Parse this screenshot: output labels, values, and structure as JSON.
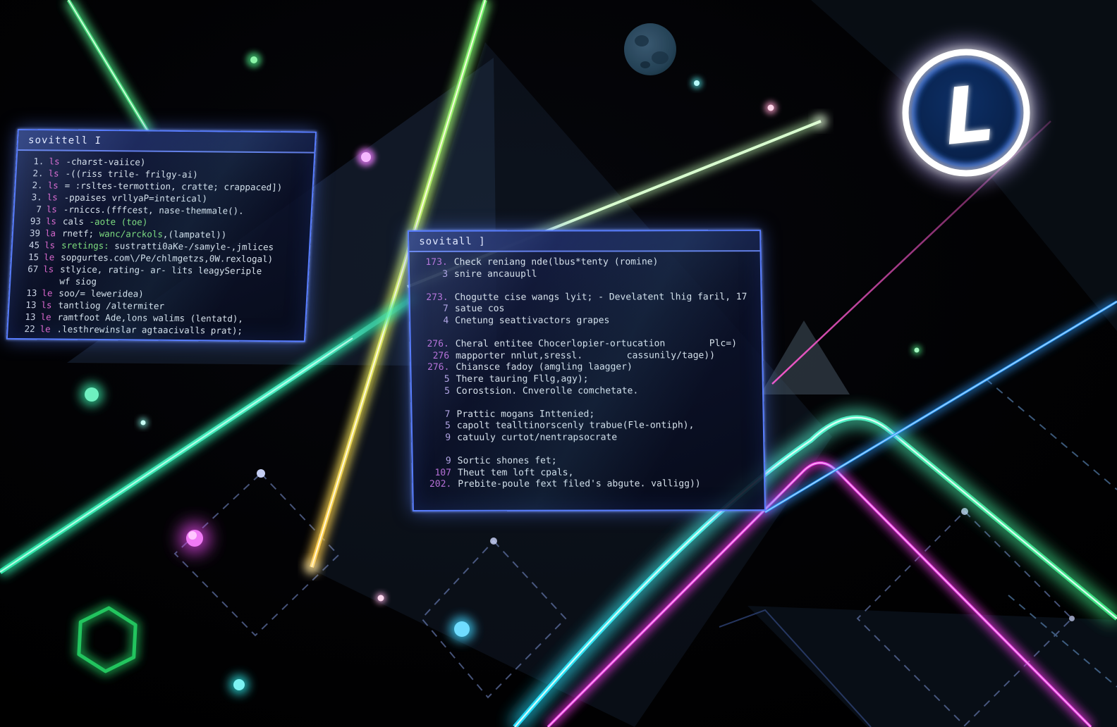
{
  "scene": {
    "description": "neon cyberpunk wallpaper with two translucent terminal windows, circular L logo, moon, laser lines"
  },
  "logo": {
    "glyph": "L"
  },
  "colors": {
    "window_border": "#587dff",
    "neon_green": "#4ade80",
    "neon_cyan": "#25e0f5",
    "neon_magenta": "#e935e0",
    "neon_gold": "#ffc94a",
    "spring_line": "#2ee6a8",
    "blue_line": "#2f9dff",
    "pale_line": "#d9ffd0",
    "thin_magenta": "#ff5ad1",
    "hex_green": "#22c55e",
    "dash_slate": "#6b7fb8",
    "num_purple": "#b76fd8",
    "prompt_pink": "#d966cc",
    "text_light": "#d6e0ea",
    "token_green": "#7ddc7d"
  },
  "windows": [
    {
      "title": "sovittell I",
      "lines": [
        {
          "num": "1.",
          "prompt": "ls",
          "segs": [
            [
              "w",
              "-charst-vaiice)"
            ]
          ]
        },
        {
          "num": "2.",
          "prompt": "ls",
          "segs": [
            [
              "w",
              "-((riss trile- frilgy-ai)"
            ]
          ]
        },
        {
          "num": "2.",
          "prompt": "ls",
          "segs": [
            [
              "w",
              "= :rsltes-termottion, cratte; crappaced])"
            ]
          ]
        },
        {
          "num": "3.",
          "prompt": "ls",
          "segs": [
            [
              "w",
              "-ppaises vrllyaP=interical)"
            ]
          ]
        },
        {
          "num": "7",
          "prompt": "ls",
          "segs": [
            [
              "w",
              "-rniccs.(fffcest, nase-themmale()."
            ]
          ]
        },
        {
          "num": "93",
          "prompt": "ls",
          "segs": [
            [
              "w",
              "cals "
            ],
            [
              "g",
              "-aote (toe)"
            ]
          ]
        },
        {
          "num": "39",
          "prompt": "la",
          "segs": [
            [
              "w",
              "rnetf; "
            ],
            [
              "g",
              "wanc/arckols"
            ],
            [
              "w",
              ",(lampatel))"
            ]
          ]
        },
        {
          "num": "45",
          "prompt": "ls",
          "segs": [
            [
              "g",
              "sretings:"
            ],
            [
              "w",
              " sustratti0aKe-/samyle-,jmlices"
            ]
          ]
        },
        {
          "num": "15",
          "prompt": "le",
          "segs": [
            [
              "w",
              "sopgurtes.com\\/Pe/chlmgetzs,0W.rexlogal)"
            ]
          ]
        },
        {
          "num": "67",
          "prompt": "ls",
          "segs": [
            [
              "w",
              "stlyice, rating- ar- lits leagySeriple"
            ]
          ]
        },
        {
          "num": "",
          "prompt": "",
          "segs": [
            [
              "w",
              "wf siog"
            ]
          ]
        },
        {
          "num": "13",
          "prompt": "le",
          "segs": [
            [
              "w",
              "soo/= leweridea)"
            ]
          ]
        },
        {
          "num": "13",
          "prompt": "ls",
          "segs": [
            [
              "w",
              "tantliog /altermiter"
            ]
          ]
        },
        {
          "num": "13",
          "prompt": "le",
          "segs": [
            [
              "w",
              "ramtfoot Ade,lons walims (lentatd),"
            ]
          ]
        },
        {
          "num": "22",
          "prompt": "le",
          "segs": [
            [
              "w",
              ".lesthrewinslar agtaacivalls prat);"
            ]
          ]
        }
      ]
    },
    {
      "title": "sovitall ]",
      "lines": [
        {
          "num": "173.",
          "segs": [
            [
              "w",
              "Check reniang nde(lbus*tenty (romine)"
            ]
          ]
        },
        {
          "num": "3",
          "nc": "sm",
          "segs": [
            [
              "w",
              "snire ancauupll"
            ]
          ]
        },
        {
          "num": "",
          "segs": []
        },
        {
          "num": "273.",
          "segs": [
            [
              "w",
              "Chogutte cise wangs lyit; - Develatent lhig faril, 17"
            ]
          ]
        },
        {
          "num": "7",
          "nc": "sm",
          "segs": [
            [
              "w",
              "satue cos"
            ]
          ]
        },
        {
          "num": "4",
          "nc": "sm",
          "segs": [
            [
              "w",
              "Cnetung seattivactors grapes"
            ]
          ]
        },
        {
          "num": "",
          "segs": []
        },
        {
          "num": "276.",
          "segs": [
            [
              "w",
              "Cheral entitee Chocerlopier-ortucation        Plc=)"
            ]
          ]
        },
        {
          "num": "276",
          "segs": [
            [
              "w",
              "mapporter nnlut,sressl.        cassunily/tage))"
            ]
          ]
        },
        {
          "num": "276.",
          "segs": [
            [
              "w",
              "Chiansce fadoy (amgling laagger)"
            ]
          ]
        },
        {
          "num": "5",
          "nc": "sm",
          "segs": [
            [
              "w",
              "There tauring Fllg,agy);"
            ]
          ]
        },
        {
          "num": "5",
          "nc": "sm",
          "segs": [
            [
              "w",
              "Corostsion. Cnverolle comchetate."
            ]
          ]
        },
        {
          "num": "",
          "segs": []
        },
        {
          "num": "7",
          "nc": "sm",
          "segs": [
            [
              "w",
              "Prattic mogans Inttenied;"
            ]
          ]
        },
        {
          "num": "5",
          "nc": "sm",
          "segs": [
            [
              "w",
              "capolt tealltinorscenly trabue(Fle-ontiph),"
            ]
          ]
        },
        {
          "num": "9",
          "nc": "sm",
          "segs": [
            [
              "w",
              "catuuly curtot/nentrapsocrate"
            ]
          ]
        },
        {
          "num": "",
          "segs": []
        },
        {
          "num": "9",
          "nc": "sm",
          "segs": [
            [
              "w",
              "Sortic shones fet;"
            ]
          ]
        },
        {
          "num": "107",
          "segs": [
            [
              "w",
              "Theut tem loft cpals,"
            ]
          ]
        },
        {
          "num": "202.",
          "segs": [
            [
              "w",
              "Prebite-poule fext filed's abgute. valligg))"
            ]
          ]
        }
      ]
    }
  ]
}
